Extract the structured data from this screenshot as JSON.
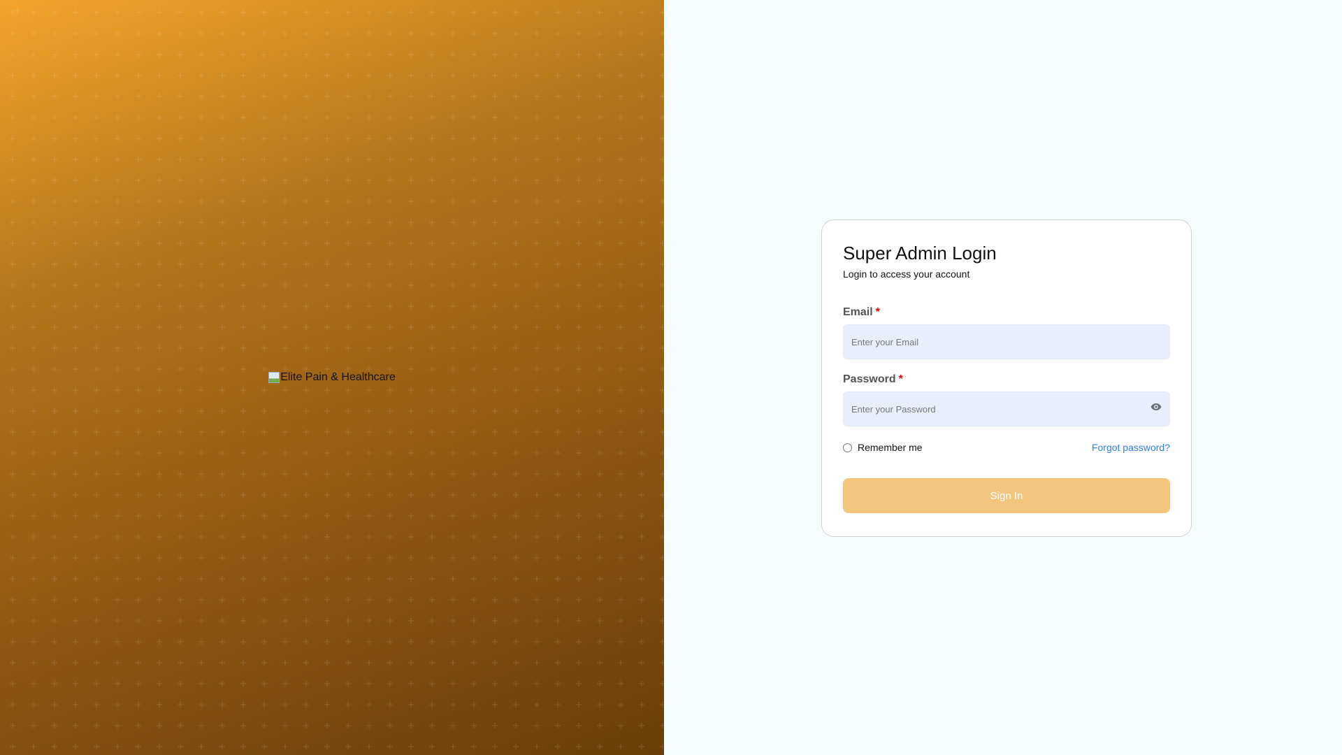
{
  "brand": {
    "logo_alt": "Elite Pain & Healthcare"
  },
  "login": {
    "title": "Super Admin Login",
    "subtitle": "Login to access your account",
    "email_label": "Email",
    "email_placeholder": "Enter your Email",
    "password_label": "Password",
    "password_placeholder": "Enter your Password",
    "required_mark": "*",
    "remember_label": "Remember me",
    "forgot_label": "Forgot password?",
    "submit_label": "Sign In"
  },
  "colors": {
    "accent": "#f4c57c",
    "link": "#2f7ff0",
    "required": "#e00000"
  }
}
